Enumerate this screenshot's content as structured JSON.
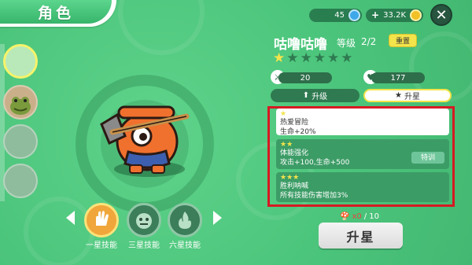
{
  "header": {
    "title": "角色"
  },
  "currency": {
    "gems": "45",
    "coins": "33.2K",
    "plus": "+"
  },
  "character": {
    "name": "咕噜咕噜",
    "level_label": "等级",
    "level_value": "2/2",
    "reset_label": "重置"
  },
  "stars": {
    "filled": 1,
    "total": 6
  },
  "stats": {
    "attack": "20",
    "health": "177"
  },
  "tabs": [
    {
      "label": "升级",
      "active": false
    },
    {
      "label": "升星",
      "active": true
    }
  ],
  "perks": [
    {
      "stars": "★",
      "title": "热爱冒险",
      "desc": "生命+20%"
    },
    {
      "stars": "★★",
      "title": "体能强化",
      "desc": "攻击+100,生命+500",
      "button": "特训"
    },
    {
      "stars": "★★★",
      "title": "胜利呐喊",
      "desc": "所有技能伤害增加3%"
    }
  ],
  "skills": [
    {
      "label": "一星技能"
    },
    {
      "label": "三星技能"
    },
    {
      "label": "六星技能"
    }
  ],
  "fragments": {
    "count": "x0",
    "total": "/ 10"
  },
  "upstar_button": "升星",
  "colors": {
    "accent_yellow": "#f3e44b",
    "highlight_red": "#d61a23",
    "bg_green": "#4ec97e"
  }
}
